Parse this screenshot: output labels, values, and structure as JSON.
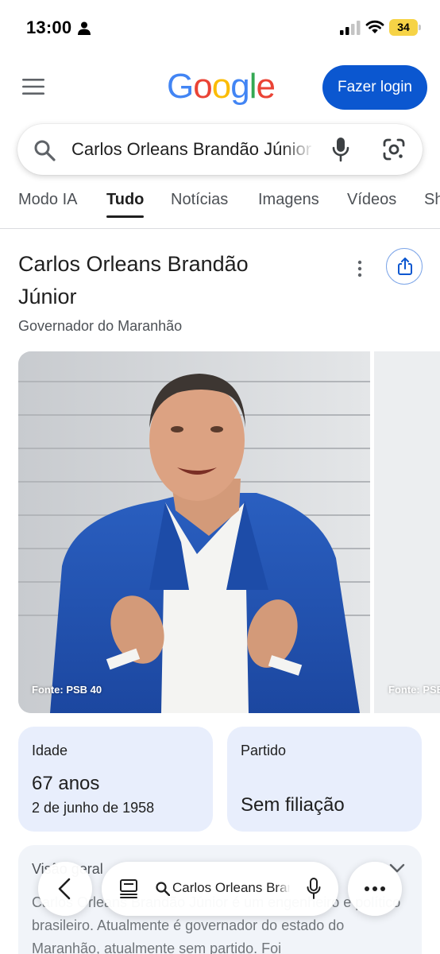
{
  "status_bar": {
    "time": "13:00",
    "battery": "34"
  },
  "header": {
    "logo_letters": [
      {
        "char": "G",
        "color": "#4285f4"
      },
      {
        "char": "o",
        "color": "#ea4335"
      },
      {
        "char": "o",
        "color": "#fbbc05"
      },
      {
        "char": "g",
        "color": "#4285f4"
      },
      {
        "char": "l",
        "color": "#34a853"
      },
      {
        "char": "e",
        "color": "#ea4335"
      }
    ],
    "login_label": "Fazer login",
    "accent_color": "#0b57d0"
  },
  "search": {
    "query": "Carlos Orleans Brandão Júnior"
  },
  "tabs": [
    {
      "label": "Modo IA",
      "active": false
    },
    {
      "label": "Tudo",
      "active": true
    },
    {
      "label": "Notícias",
      "active": false
    },
    {
      "label": "Imagens",
      "active": false
    },
    {
      "label": "Vídeos",
      "active": false
    },
    {
      "label": "Sh",
      "active": false
    }
  ],
  "knowledge_panel": {
    "title": "Carlos Orleans Brandão Júnior",
    "subtitle": "Governador do Maranhão",
    "images": [
      {
        "credit": "Fonte: PSB 40"
      },
      {
        "credit": "Fonte: PSB"
      }
    ],
    "facts": {
      "age": {
        "label": "Idade",
        "value": "67 anos",
        "detail": "2 de junho de 1958"
      },
      "party": {
        "label": "Partido",
        "value": "Sem filiação"
      }
    },
    "overview": {
      "label": "Visão geral",
      "text": "Carlos Orleans Brandão Júnior é um engenheiro e político brasileiro. Atualmente é governador do estado do Maranhão, atualmente sem partido. Foi"
    }
  },
  "bottom_bar": {
    "query": "Carlos Orleans Brandão Júnior"
  }
}
